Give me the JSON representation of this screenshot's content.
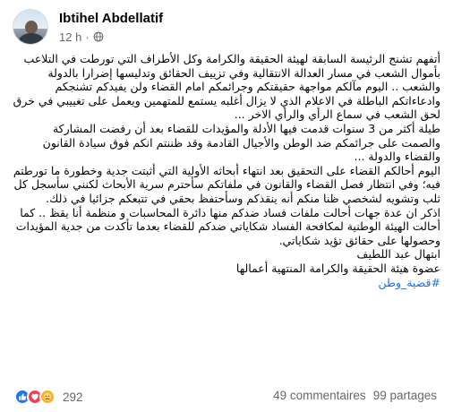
{
  "post": {
    "author": "Ibtihel Abdellatif",
    "time": "12 h",
    "separator": "·",
    "privacy_icon": "globe-icon",
    "paragraphs": [
      "أتفهم تشنج الرئيسة السابقة لهيئة الحقيقة والكرامة وكل الأطراف التي تورطت في التلاعب بأموال الشعب في مسار العدالة الانتقالية وفي تزييف الحقائق وتدليسها إضرارا بالدولة والشعب .. اليوم مآلكم مواجهة حقيقتكم وجرائمكم امام القضاء ولن يفيدكم تشنجكم وادعاءاتكم الباطلة في الاعلام الذي لا يزال أغلبه يستمع للمتهمين ويعمل على تغييبي في خرق لحق الشعب في سماع الرأي والرأي الاخر ...",
      "طيلة أكثر من 3 سنوات قدمت فيها الأدلة والمؤيدات للقضاء بعد أن رفضت المشاركة والصمت على جرائمكم ضد الوطن والأجيال القادمة وقد ظننتم انكم فوق سيادة القانون والقضاء والدولة ...",
      "اليوم أحالكم القضاء على التحقيق بعد انتهاء أبحاثه الأولية التي أثبتت جدية وخطورة ما تورطتم فيه؛ وفي انتظار فصل القضاء والقانون في ملفاتكم سأحترم سرية الأبحاث لكنني سأسجل كل ثلب وتشويه لشخصي ظنا منكم أنه ينقذكم وسأحتفظ بحقي في تتبعكم جزائيا في ذلك.",
      "اذكر ان عدة جهات أحالت ملفات فساد ضدكم منها دائرة المحاسبات و منظمة أنا يقظ .. كما أحالت الهيئة الوطنية لمكافحة الفساد شكاياتي ضدكم للقضاء بعدما تأكدت من جدية المؤيدات وحصولها على حقائق تؤيد شكاياتي.",
      "ابتهال عبد اللطيف",
      "عضوة هيئة الحقيقة والكرامة المنتهية أعمالها"
    ],
    "hashtag": "#قضية_وطن"
  },
  "reactions": {
    "icons": [
      "like-icon",
      "love-icon",
      "care-icon"
    ],
    "count": "292",
    "comments": "49 commentaires",
    "shares": "99 partages"
  },
  "colors": {
    "like": "#1877f2",
    "love": "#f33e58",
    "care": "#f7b125",
    "link": "#216fdb",
    "muted": "#65676b"
  }
}
